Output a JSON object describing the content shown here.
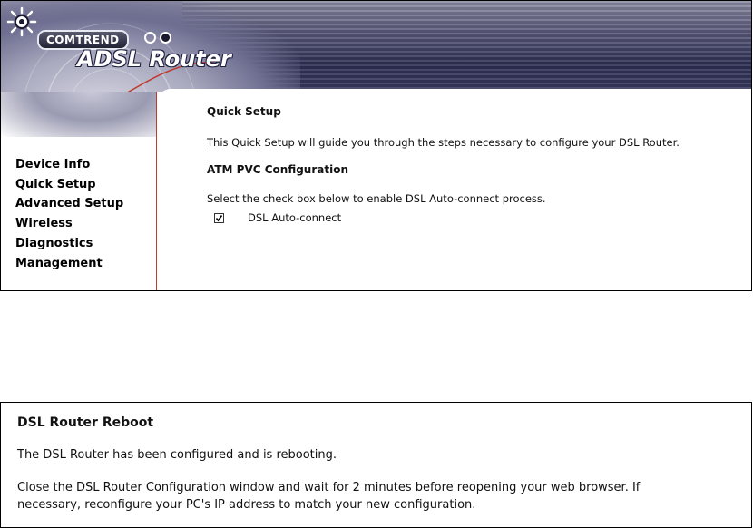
{
  "header": {
    "brand": "COMTREND",
    "product": "ADSL Router"
  },
  "sidebar": {
    "items": [
      {
        "label": "Device Info"
      },
      {
        "label": "Quick Setup"
      },
      {
        "label": "Advanced Setup"
      },
      {
        "label": "Wireless"
      },
      {
        "label": "Diagnostics"
      },
      {
        "label": "Management"
      }
    ]
  },
  "quick_setup": {
    "title": "Quick Setup",
    "intro": "This Quick Setup will guide you through the steps necessary to configure your DSL Router.",
    "atm_title": "ATM PVC Configuration",
    "instruction": "Select the check box below to enable DSL Auto-connect process.",
    "auto_connect": {
      "label": "DSL Auto-connect",
      "checked": true
    }
  },
  "reboot": {
    "title": "DSL Router Reboot",
    "status": "The DSL Router has been configured and is rebooting.",
    "instructions_line1": "Close the DSL Router Configuration window and wait for 2 minutes before reopening your web browser. If",
    "instructions_line2": "necessary, reconfigure your PC's IP address to match your new configuration."
  },
  "colors": {
    "banner_dark": "#2f2f55",
    "sidebar_border": "#c0392b",
    "text": "#111111"
  }
}
